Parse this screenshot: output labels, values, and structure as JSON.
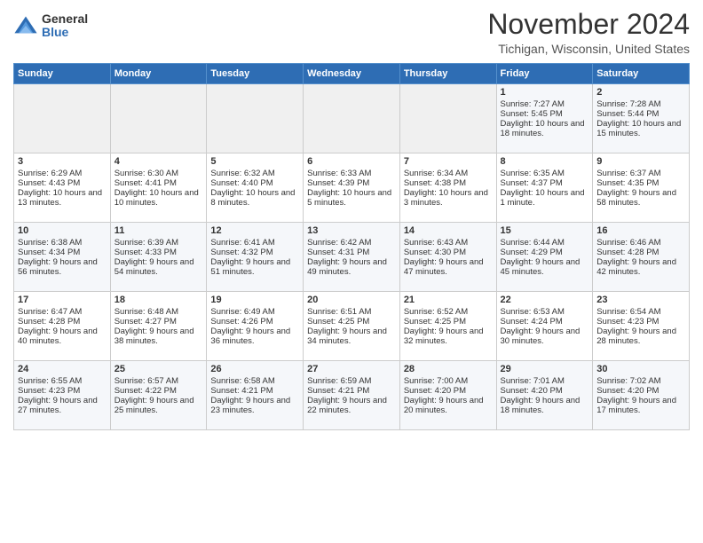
{
  "logo": {
    "general": "General",
    "blue": "Blue"
  },
  "title": "November 2024",
  "location": "Tichigan, Wisconsin, United States",
  "days_of_week": [
    "Sunday",
    "Monday",
    "Tuesday",
    "Wednesday",
    "Thursday",
    "Friday",
    "Saturday"
  ],
  "weeks": [
    [
      {
        "day": "",
        "info": ""
      },
      {
        "day": "",
        "info": ""
      },
      {
        "day": "",
        "info": ""
      },
      {
        "day": "",
        "info": ""
      },
      {
        "day": "",
        "info": ""
      },
      {
        "day": "1",
        "info": "Sunrise: 7:27 AM\nSunset: 5:45 PM\nDaylight: 10 hours and 18 minutes."
      },
      {
        "day": "2",
        "info": "Sunrise: 7:28 AM\nSunset: 5:44 PM\nDaylight: 10 hours and 15 minutes."
      }
    ],
    [
      {
        "day": "3",
        "info": "Sunrise: 6:29 AM\nSunset: 4:43 PM\nDaylight: 10 hours and 13 minutes."
      },
      {
        "day": "4",
        "info": "Sunrise: 6:30 AM\nSunset: 4:41 PM\nDaylight: 10 hours and 10 minutes."
      },
      {
        "day": "5",
        "info": "Sunrise: 6:32 AM\nSunset: 4:40 PM\nDaylight: 10 hours and 8 minutes."
      },
      {
        "day": "6",
        "info": "Sunrise: 6:33 AM\nSunset: 4:39 PM\nDaylight: 10 hours and 5 minutes."
      },
      {
        "day": "7",
        "info": "Sunrise: 6:34 AM\nSunset: 4:38 PM\nDaylight: 10 hours and 3 minutes."
      },
      {
        "day": "8",
        "info": "Sunrise: 6:35 AM\nSunset: 4:37 PM\nDaylight: 10 hours and 1 minute."
      },
      {
        "day": "9",
        "info": "Sunrise: 6:37 AM\nSunset: 4:35 PM\nDaylight: 9 hours and 58 minutes."
      }
    ],
    [
      {
        "day": "10",
        "info": "Sunrise: 6:38 AM\nSunset: 4:34 PM\nDaylight: 9 hours and 56 minutes."
      },
      {
        "day": "11",
        "info": "Sunrise: 6:39 AM\nSunset: 4:33 PM\nDaylight: 9 hours and 54 minutes."
      },
      {
        "day": "12",
        "info": "Sunrise: 6:41 AM\nSunset: 4:32 PM\nDaylight: 9 hours and 51 minutes."
      },
      {
        "day": "13",
        "info": "Sunrise: 6:42 AM\nSunset: 4:31 PM\nDaylight: 9 hours and 49 minutes."
      },
      {
        "day": "14",
        "info": "Sunrise: 6:43 AM\nSunset: 4:30 PM\nDaylight: 9 hours and 47 minutes."
      },
      {
        "day": "15",
        "info": "Sunrise: 6:44 AM\nSunset: 4:29 PM\nDaylight: 9 hours and 45 minutes."
      },
      {
        "day": "16",
        "info": "Sunrise: 6:46 AM\nSunset: 4:28 PM\nDaylight: 9 hours and 42 minutes."
      }
    ],
    [
      {
        "day": "17",
        "info": "Sunrise: 6:47 AM\nSunset: 4:28 PM\nDaylight: 9 hours and 40 minutes."
      },
      {
        "day": "18",
        "info": "Sunrise: 6:48 AM\nSunset: 4:27 PM\nDaylight: 9 hours and 38 minutes."
      },
      {
        "day": "19",
        "info": "Sunrise: 6:49 AM\nSunset: 4:26 PM\nDaylight: 9 hours and 36 minutes."
      },
      {
        "day": "20",
        "info": "Sunrise: 6:51 AM\nSunset: 4:25 PM\nDaylight: 9 hours and 34 minutes."
      },
      {
        "day": "21",
        "info": "Sunrise: 6:52 AM\nSunset: 4:25 PM\nDaylight: 9 hours and 32 minutes."
      },
      {
        "day": "22",
        "info": "Sunrise: 6:53 AM\nSunset: 4:24 PM\nDaylight: 9 hours and 30 minutes."
      },
      {
        "day": "23",
        "info": "Sunrise: 6:54 AM\nSunset: 4:23 PM\nDaylight: 9 hours and 28 minutes."
      }
    ],
    [
      {
        "day": "24",
        "info": "Sunrise: 6:55 AM\nSunset: 4:23 PM\nDaylight: 9 hours and 27 minutes."
      },
      {
        "day": "25",
        "info": "Sunrise: 6:57 AM\nSunset: 4:22 PM\nDaylight: 9 hours and 25 minutes."
      },
      {
        "day": "26",
        "info": "Sunrise: 6:58 AM\nSunset: 4:21 PM\nDaylight: 9 hours and 23 minutes."
      },
      {
        "day": "27",
        "info": "Sunrise: 6:59 AM\nSunset: 4:21 PM\nDaylight: 9 hours and 22 minutes."
      },
      {
        "day": "28",
        "info": "Sunrise: 7:00 AM\nSunset: 4:20 PM\nDaylight: 9 hours and 20 minutes."
      },
      {
        "day": "29",
        "info": "Sunrise: 7:01 AM\nSunset: 4:20 PM\nDaylight: 9 hours and 18 minutes."
      },
      {
        "day": "30",
        "info": "Sunrise: 7:02 AM\nSunset: 4:20 PM\nDaylight: 9 hours and 17 minutes."
      }
    ]
  ]
}
